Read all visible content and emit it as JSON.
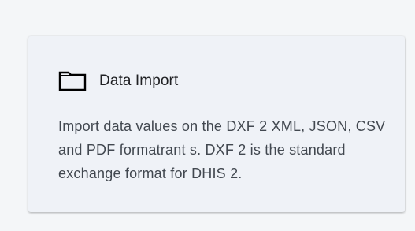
{
  "card": {
    "icon": "folder-icon",
    "title": "Data Import",
    "description": "Import data values on the DXF 2 XML, JSON, CSV and PDF formatrant s. DXF 2 is the standard exchange format for DHIS 2."
  },
  "colors": {
    "page_background": "#f4f6f8",
    "card_background": "#eff2f7",
    "title_text": "#202124",
    "body_text": "#424850"
  }
}
